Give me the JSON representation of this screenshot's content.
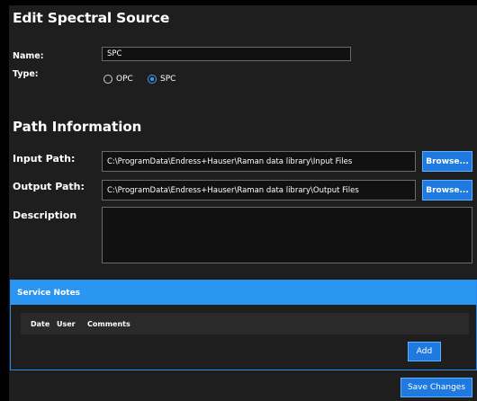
{
  "dialog": {
    "title": "Edit Spectral Source"
  },
  "form": {
    "name_label": "Name:",
    "name_value": "SPC",
    "type_label": "Type:",
    "type_options": [
      {
        "label": "OPC",
        "selected": false
      },
      {
        "label": "SPC",
        "selected": true
      }
    ]
  },
  "path_info": {
    "heading": "Path Information",
    "input_label": "Input Path:",
    "input_value": "C:\\ProgramData\\Endress+Hauser\\Raman data library\\Input Files",
    "output_label": "Output Path:",
    "output_value": "C:\\ProgramData\\Endress+Hauser\\Raman data library\\Output Files",
    "browse_label": "Browse...",
    "description_label": "Description",
    "description_value": ""
  },
  "service_notes": {
    "heading": "Service Notes",
    "columns": [
      "Date",
      "User",
      "Comments"
    ],
    "add_label": "Add"
  },
  "footer": {
    "save_label": "Save Changes"
  },
  "colors": {
    "accent": "#2b96f2",
    "button": "#1e7ae0",
    "background": "#1e1e1e"
  }
}
